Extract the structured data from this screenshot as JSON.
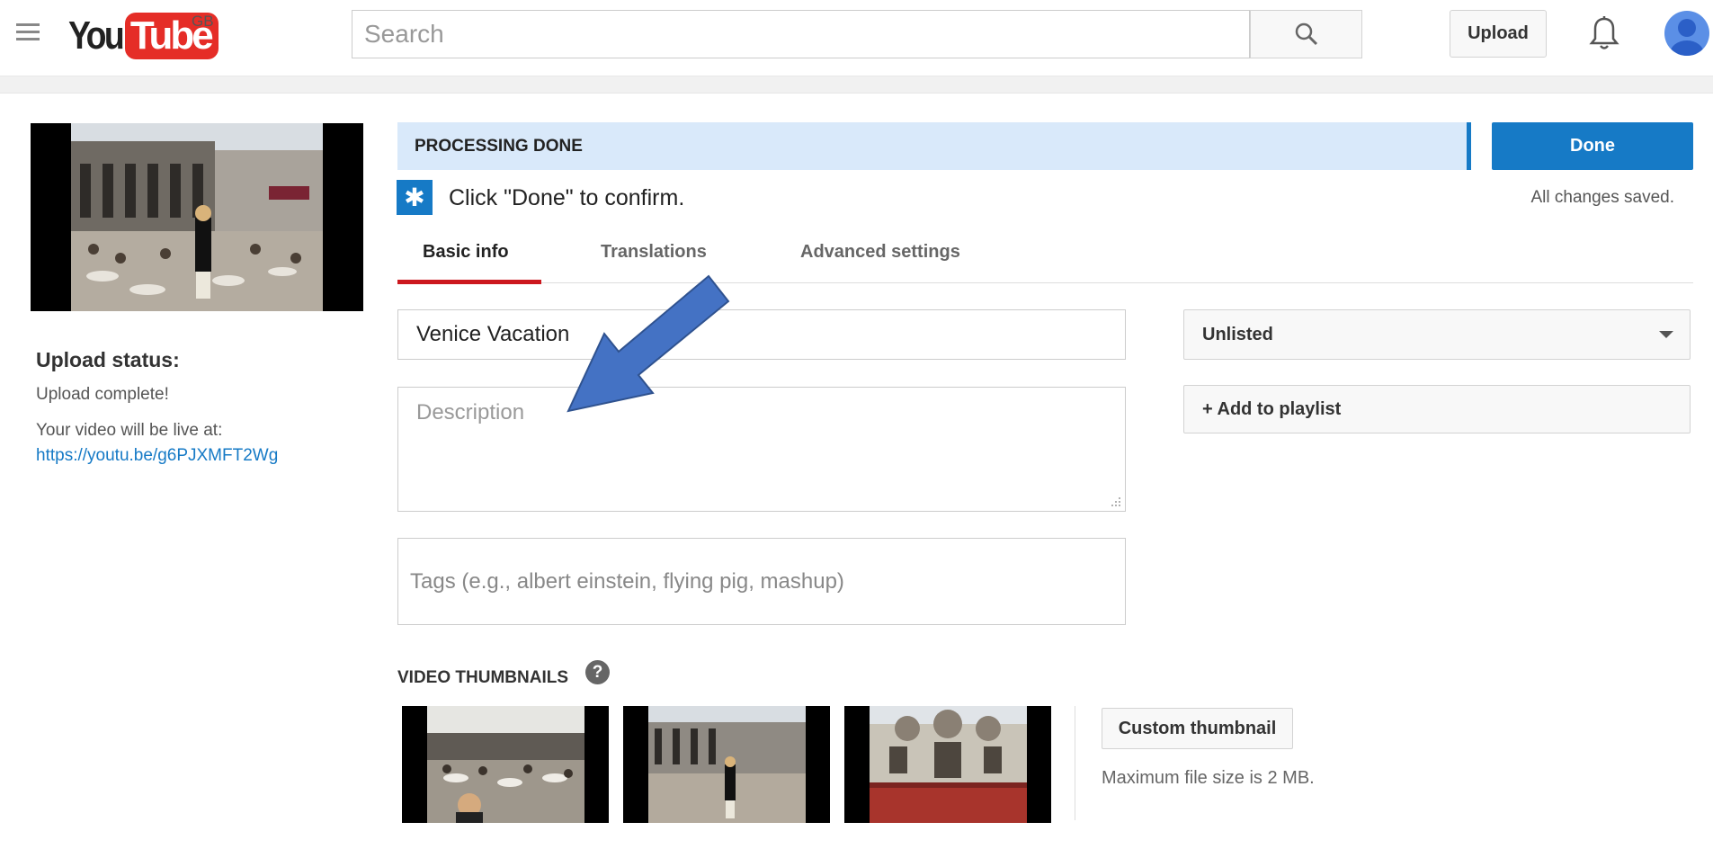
{
  "header": {
    "logo_you": "You",
    "logo_tube": "Tube",
    "region": "GB",
    "search_placeholder": "Search",
    "upload_label": "Upload"
  },
  "sidebar": {
    "upload_status_title": "Upload status:",
    "upload_complete": "Upload complete!",
    "live_at": "Your video will be live at:",
    "video_link": "https://youtu.be/g6PJXMFT2Wg"
  },
  "status": {
    "processing": "PROCESSING DONE",
    "done_label": "Done",
    "confirm": "Click \"Done\" to confirm.",
    "saved": "All changes saved."
  },
  "tabs": [
    {
      "label": "Basic info",
      "active": true
    },
    {
      "label": "Translations",
      "active": false
    },
    {
      "label": "Advanced settings",
      "active": false
    }
  ],
  "form": {
    "title_value": "Venice Vacation",
    "description_placeholder": "Description",
    "tags_placeholder": "Tags (e.g., albert einstein, flying pig, mashup)",
    "privacy_value": "Unlisted",
    "playlist_label": "+ Add to playlist"
  },
  "thumbnails": {
    "title": "VIDEO THUMBNAILS",
    "help_glyph": "?",
    "custom_label": "Custom thumbnail",
    "max_size": "Maximum file size is 2 MB."
  },
  "colors": {
    "brand_red": "#e52d27",
    "accent_blue": "#167ac6",
    "arrow_blue": "#4472c4"
  }
}
